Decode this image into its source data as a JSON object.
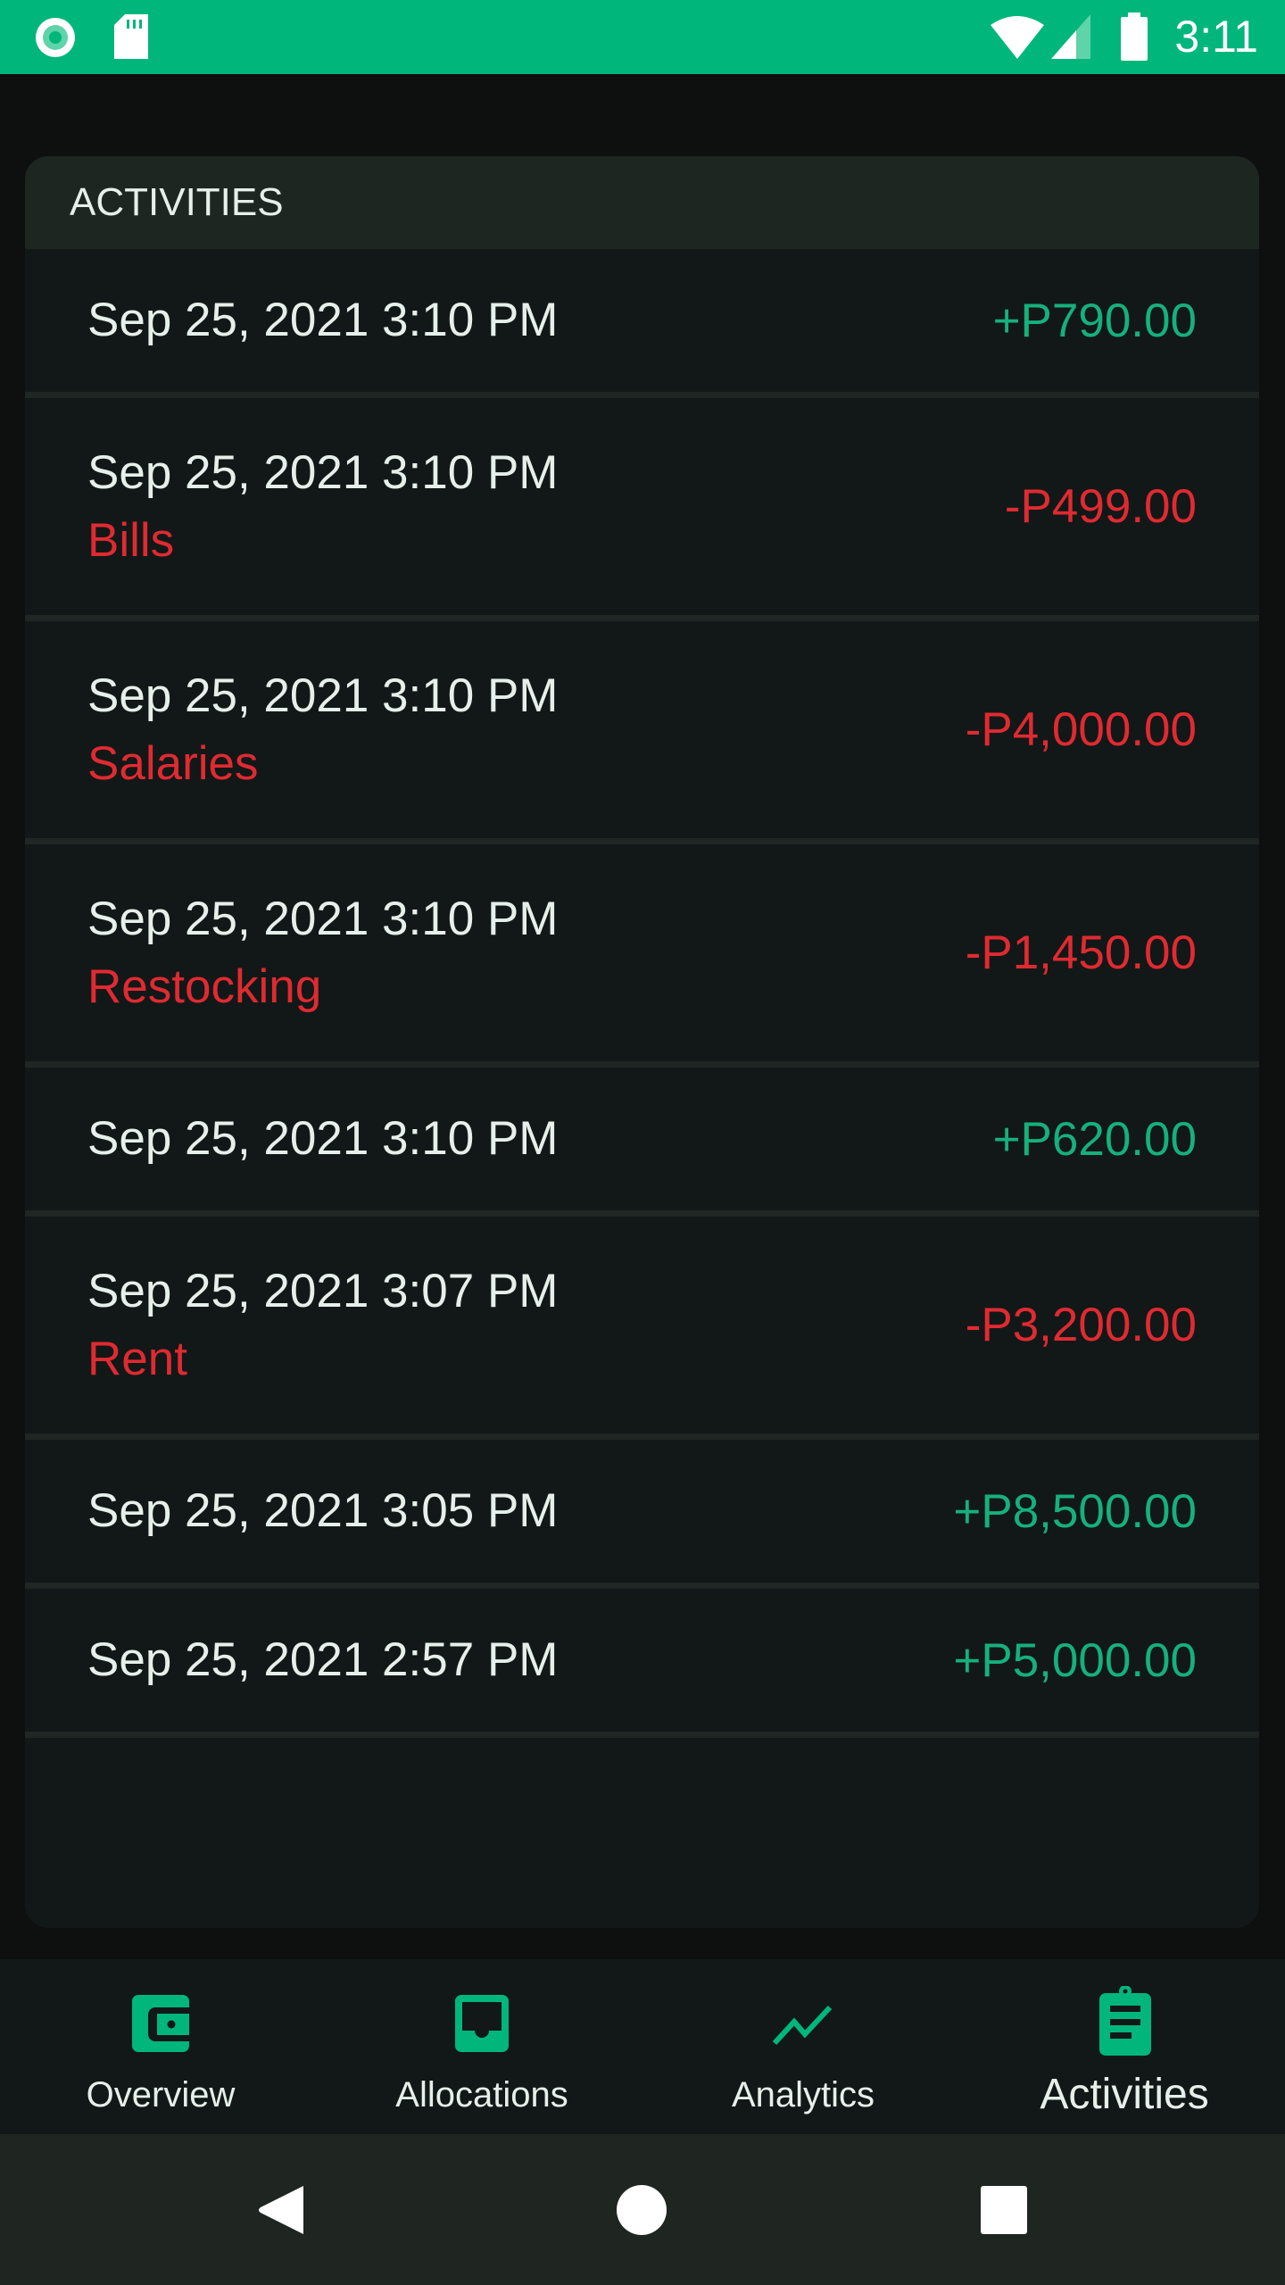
{
  "status_bar": {
    "time": "3:11",
    "icons": [
      "record-icon",
      "sd-card-icon",
      "wifi-icon",
      "cellular-signal-icon",
      "battery-icon"
    ],
    "background_color": "#00b67a"
  },
  "activities_card": {
    "title": "ACTIVITIES",
    "items": [
      {
        "datetime": "Sep 25, 2021 3:10 PM",
        "category": "",
        "amount": "+P790.00",
        "type": "income"
      },
      {
        "datetime": "Sep 25, 2021 3:10 PM",
        "category": "Bills",
        "amount": "-P499.00",
        "type": "expense"
      },
      {
        "datetime": "Sep 25, 2021 3:10 PM",
        "category": "Salaries",
        "amount": "-P4,000.00",
        "type": "expense"
      },
      {
        "datetime": "Sep 25, 2021 3:10 PM",
        "category": "Restocking",
        "amount": "-P1,450.00",
        "type": "expense"
      },
      {
        "datetime": "Sep 25, 2021 3:10 PM",
        "category": "",
        "amount": "+P620.00",
        "type": "income"
      },
      {
        "datetime": "Sep 25, 2021 3:07 PM",
        "category": "Rent",
        "amount": "-P3,200.00",
        "type": "expense"
      },
      {
        "datetime": "Sep 25, 2021 3:05 PM",
        "category": "",
        "amount": "+P8,500.00",
        "type": "income"
      },
      {
        "datetime": "Sep 25, 2021 2:57 PM",
        "category": "",
        "amount": "+P5,000.00",
        "type": "income"
      }
    ]
  },
  "bottom_nav": {
    "items": [
      {
        "label": "Overview",
        "icon": "wallet-icon",
        "active": false
      },
      {
        "label": "Allocations",
        "icon": "inbox-icon",
        "active": false
      },
      {
        "label": "Analytics",
        "icon": "trending-up-icon",
        "active": false
      },
      {
        "label": "Activities",
        "icon": "clipboard-icon",
        "active": true
      }
    ]
  },
  "system_nav": {
    "buttons": [
      "back",
      "home",
      "recents"
    ]
  },
  "colors": {
    "accent": "#00b67a",
    "income": "#16b07c",
    "expense": "#e02a31",
    "text": "#e6efea"
  }
}
